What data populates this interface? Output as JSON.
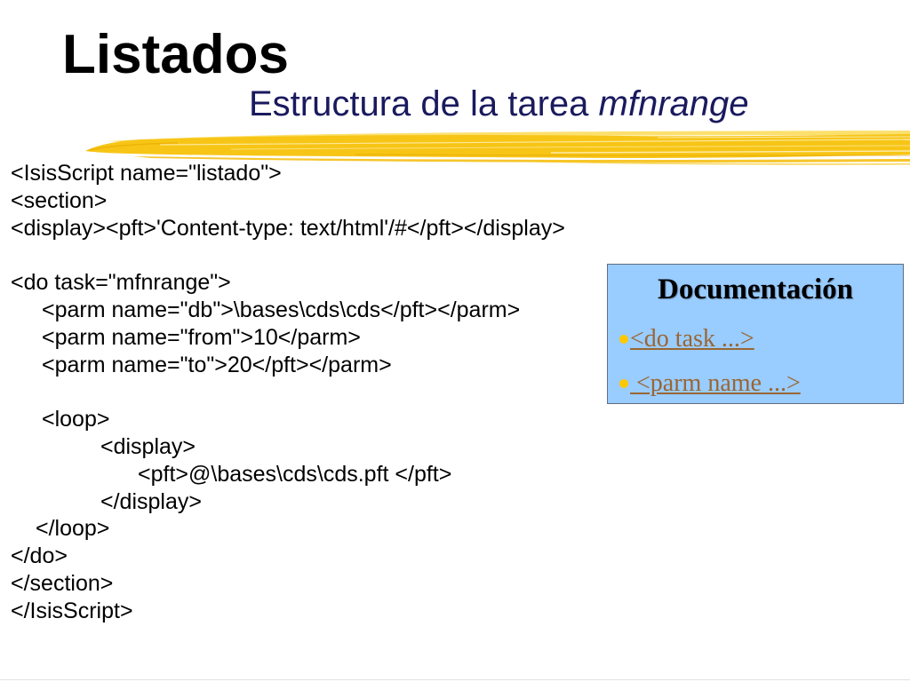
{
  "slide": {
    "title": "Listados",
    "subtitle": {
      "text": "Estructura de la tarea",
      "task_name": "mfnrange"
    }
  },
  "code": {
    "lines": [
      "<IsisScript name=\"listado\">",
      "<section>",
      "<display><pft>'Content-type: text/html'/#</pft></display>",
      "<do task=\"mfnrange\">",
      "<parm name=\"db\">\\bases\\cds\\cds</pft></parm>",
      "<parm name=\"from\">10</parm>",
      "<parm name=\"to\">20</pft></parm>",
      "<loop>",
      "<display>",
      "<pft>@\\bases\\cds\\cds.pft </pft>",
      "</display>",
      "</loop>",
      "</do>",
      "</section>",
      "</IsisScript>"
    ]
  },
  "doc_box": {
    "title": "Documentación",
    "bullet_icon": "bullet-dot-icon",
    "items": [
      {
        "label": "<do task ...>"
      },
      {
        "label": " <parm name ...>"
      }
    ]
  },
  "colors": {
    "title": "#000000",
    "subtitle": "#1a1a5e",
    "doc_box_background": "#99ccff",
    "doc_box_border": "#5f6f82",
    "link": "#996633",
    "bullet": "#ffc800",
    "brush": "#f7c516"
  }
}
